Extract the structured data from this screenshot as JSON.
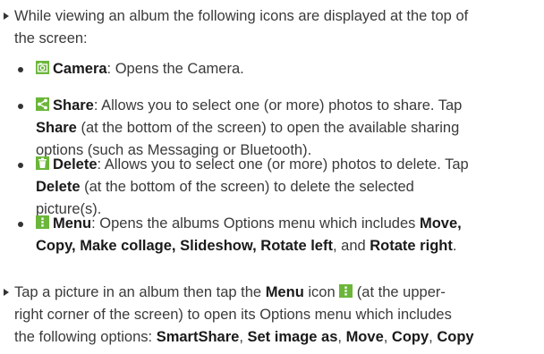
{
  "intro": {
    "line1": "While viewing an album the following icons are displayed at the top of",
    "line2": "the screen:"
  },
  "icons": {
    "camera": "camera-icon",
    "share": "share-icon",
    "delete": "trash-icon",
    "menu": "menu-icon"
  },
  "colors": {
    "icon_accent": "#6bb63a"
  },
  "camera": {
    "label": "Camera",
    "desc": ": Opens the Camera."
  },
  "share": {
    "label": "Share",
    "line1": ": Allows you to select one (or more) photos to share. Tap",
    "share_word": "Share",
    "line2": " (at the bottom of the screen) to open the available sharing",
    "line3": "options (such as Messaging or Bluetooth)."
  },
  "delete": {
    "label": "Delete",
    "line1": ": Allows you to select one (or more) photos to delete. Tap",
    "delete_word": "Delete",
    "line2": " (at the bottom of the screen) to delete the selected",
    "line3": "picture(s)."
  },
  "menu": {
    "label": "Menu",
    "line1_pre": ": Opens the albums Options menu which includes ",
    "move": "Move,",
    "copy": "Copy,",
    "collage": "Make collage,",
    "slideshow": "Slideshow,",
    "rotate_left": "Rotate left",
    "sep_and": ", and ",
    "rotate_right": "Rotate right",
    "period": "."
  },
  "tap": {
    "pre": "Tap a picture in an album then tap the ",
    "menu_word": "Menu",
    "icon_word": " icon ",
    "line1_post": " (at the upper-",
    "line2": "right corner of the screen) to open its Options menu which includes",
    "line3_pre": "the following options: ",
    "smartshare": "SmartShare",
    "set_image": "Set image as",
    "move": "Move",
    "copy": "Copy",
    "copy2": "Copy",
    "comma": ", "
  }
}
